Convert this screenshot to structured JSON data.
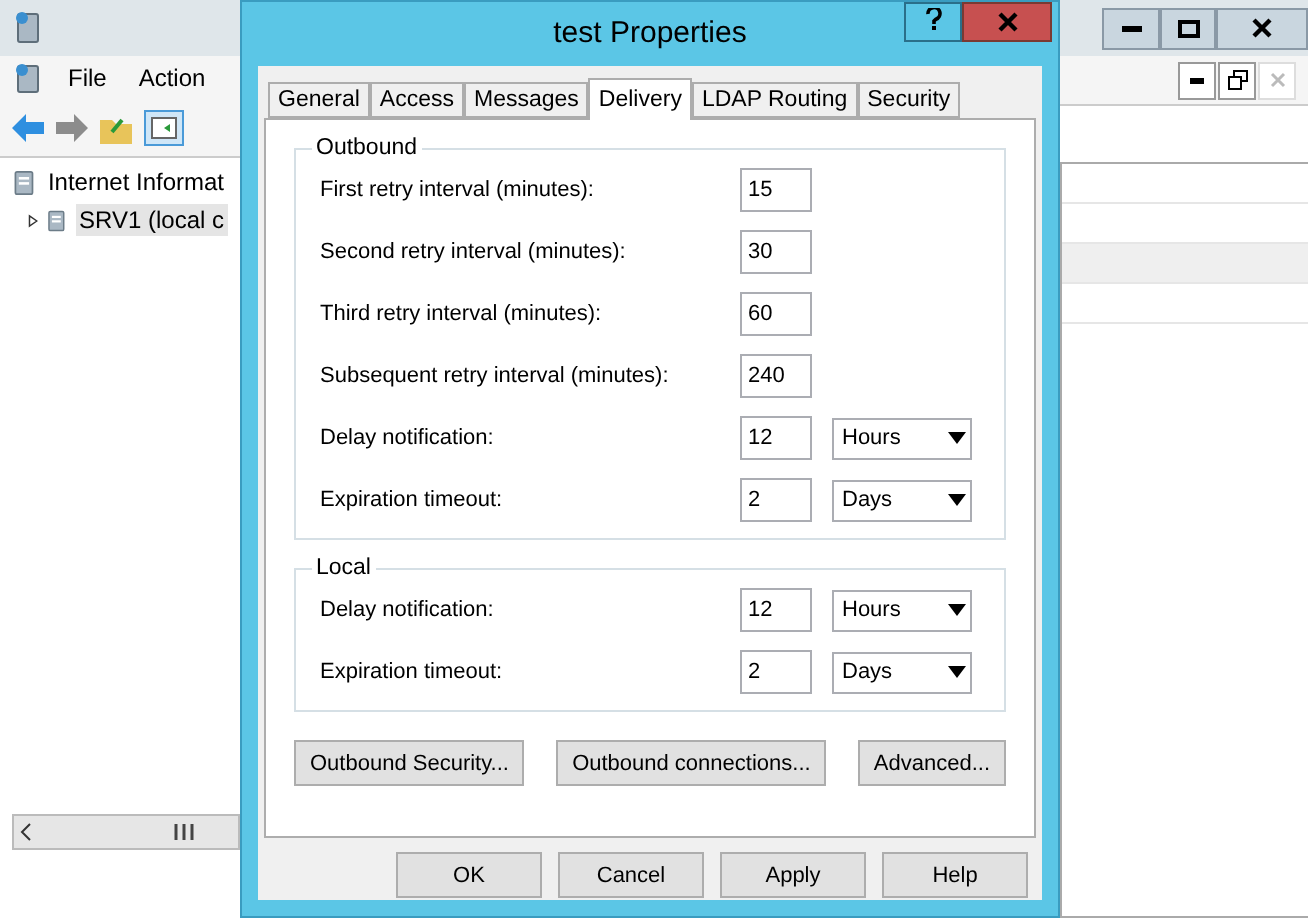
{
  "background_window": {
    "menu": [
      "File",
      "Action"
    ],
    "tree": [
      {
        "label": "Internet Informat",
        "children": [
          {
            "label": "SRV1 (local c",
            "expanded": false,
            "selected": true
          }
        ]
      }
    ]
  },
  "dialog": {
    "title": "test Properties",
    "tabs": [
      {
        "label": "General",
        "selected": false
      },
      {
        "label": "Access",
        "selected": false
      },
      {
        "label": "Messages",
        "selected": false
      },
      {
        "label": "Delivery",
        "selected": true
      },
      {
        "label": "LDAP Routing",
        "selected": false
      },
      {
        "label": "Security",
        "selected": false
      }
    ],
    "groups": [
      {
        "title": "Outbound",
        "rows": [
          {
            "label": "First retry interval (minutes):",
            "value": "15"
          },
          {
            "label": "Second retry interval (minutes):",
            "value": "30"
          },
          {
            "label": "Third retry interval (minutes):",
            "value": "60"
          },
          {
            "label": "Subsequent retry interval (minutes):",
            "value": "240"
          },
          {
            "label": "Delay notification:",
            "value": "12",
            "unit": "Hours"
          },
          {
            "label": "Expiration timeout:",
            "value": "2",
            "unit": "Days"
          }
        ]
      },
      {
        "title": "Local",
        "rows": [
          {
            "label": "Delay notification:",
            "value": "12",
            "unit": "Hours"
          },
          {
            "label": "Expiration timeout:",
            "value": "2",
            "unit": "Days"
          }
        ]
      }
    ],
    "group_buttons": [
      "Outbound Security...",
      "Outbound connections...",
      "Advanced..."
    ],
    "buttons": [
      "OK",
      "Cancel",
      "Apply",
      "Help"
    ]
  }
}
